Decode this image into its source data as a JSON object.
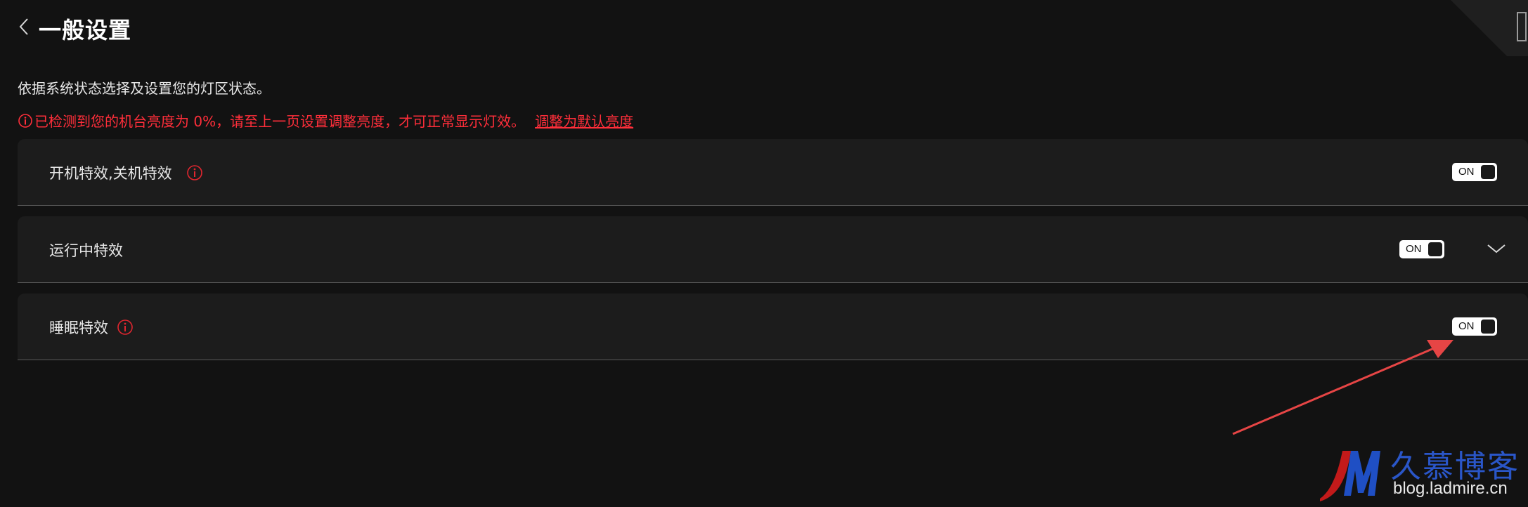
{
  "header": {
    "title": "一般设置",
    "back_icon": "chevron-left-icon"
  },
  "description": "依据系统状态选择及设置您的灯区状态。",
  "warning": {
    "icon": "info-circle-icon",
    "message": "已检测到您的机台亮度为 0%，请至上一页设置调整亮度，才可正常显示灯效。",
    "link_label": "调整为默认亮度",
    "color": "#ff2e3a"
  },
  "settings": [
    {
      "label": "开机特效,关机特效",
      "has_info": true,
      "toggle_label": "ON",
      "toggle_on": true,
      "expandable": false
    },
    {
      "label": "运行中特效",
      "has_info": false,
      "toggle_label": "ON",
      "toggle_on": true,
      "expandable": true
    },
    {
      "label": "睡眠特效",
      "has_info": true,
      "toggle_label": "ON",
      "toggle_on": true,
      "expandable": false
    }
  ],
  "watermark": {
    "logo_text": "JM",
    "title": "久慕博客",
    "url": "blog.ladmire.cn"
  },
  "colors": {
    "background": "#121212",
    "row_background": "#1c1c1c",
    "accent_red": "#ff2e3a",
    "annotation_arrow": "#e64545"
  }
}
